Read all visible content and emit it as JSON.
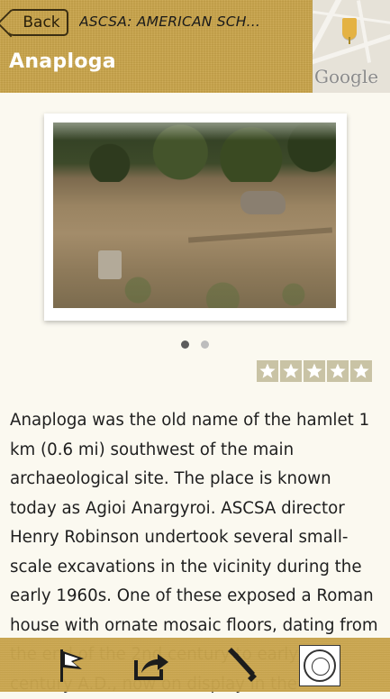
{
  "header": {
    "back_label": "Back",
    "title": "ASCSA: AMERICAN SCH...",
    "place_name": "Anaploga",
    "map_logo": "Google"
  },
  "pager": {
    "count": 2,
    "active": 0
  },
  "rating": {
    "stars": 5,
    "filled": 5
  },
  "description": "Anaploga was the old name of the hamlet 1 km (0.6 mi) southwest of the main archaeological site. The place is known today as Agioi Anargyroi. ASCSA director Henry Robinson undertook several small-scale excavations in the vicinity during the early 1960s. One of these exposed a Roman house with ornate mosaic floors, dating from the end of the 2nd century to early 3rd century A.D., now on display in the",
  "toolbar": {
    "items": [
      "flag-icon",
      "share-icon",
      "wrench-icon",
      "seal-icon"
    ]
  },
  "colors": {
    "header_bg": "#c9a449",
    "page_bg": "#fbf9f0",
    "star_bg": "#c9c3a5"
  }
}
